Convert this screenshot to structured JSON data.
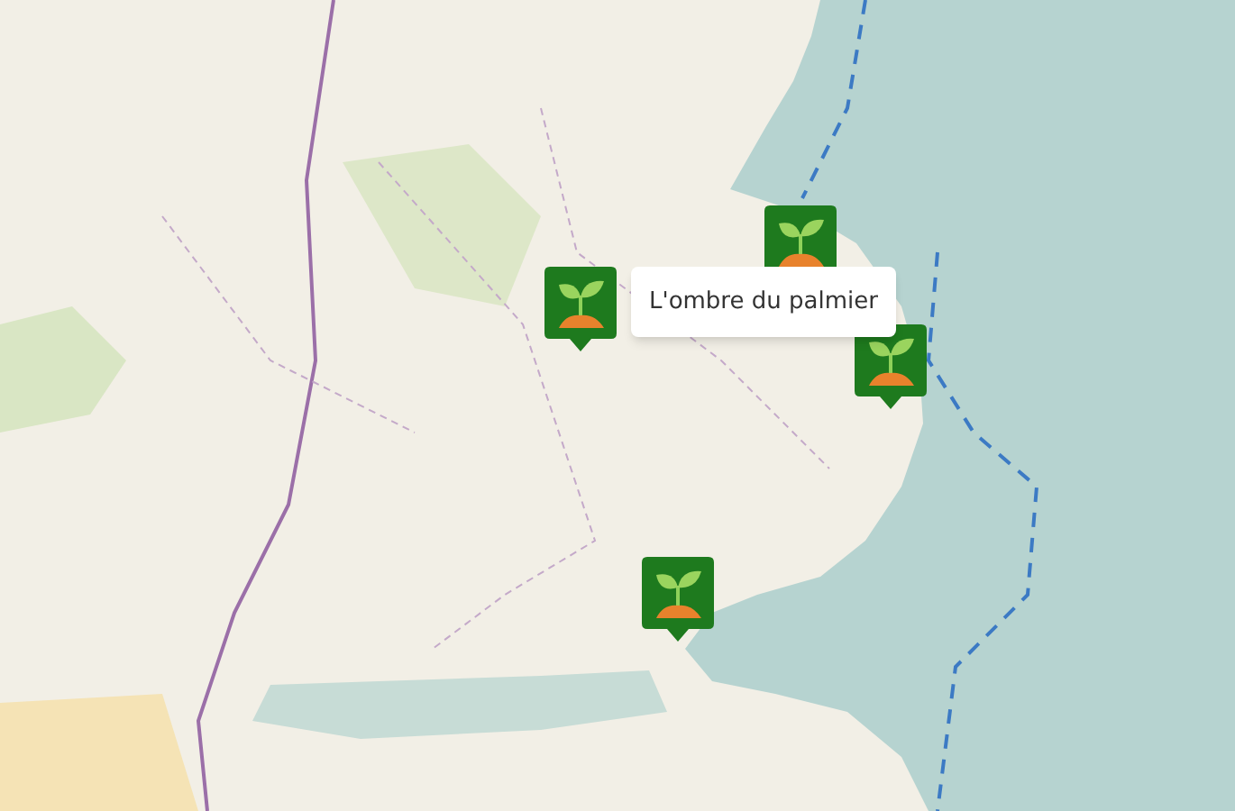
{
  "map": {
    "markers": [
      {
        "kind": "plant"
      },
      {
        "kind": "plant"
      },
      {
        "kind": "plant"
      },
      {
        "kind": "plant"
      }
    ],
    "tooltip": {
      "text": "L'ombre du palmier"
    }
  }
}
